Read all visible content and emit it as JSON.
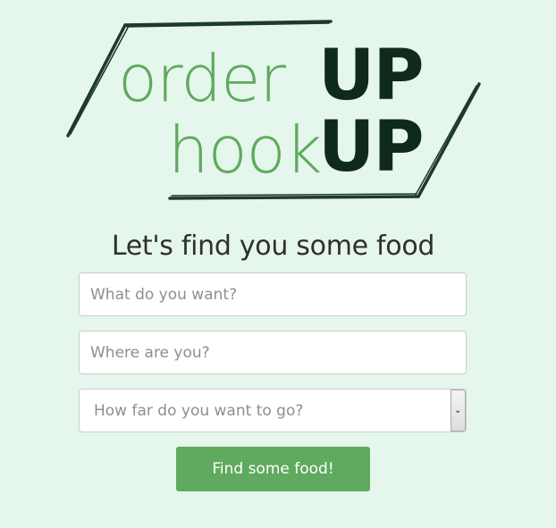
{
  "logo": {
    "line1_light": "order",
    "line1_dark": "UP",
    "line2_light": "hook",
    "line2_dark": "UP"
  },
  "heading": "Let's find you some food",
  "form": {
    "what_placeholder": "What do you want?",
    "where_placeholder": "Where are you?",
    "distance_selected": "How far do you want to go?",
    "submit_label": "Find some food!"
  },
  "colors": {
    "background": "#e5f6ec",
    "accent_green": "#5faa5e",
    "logo_dark": "#0f2a1c",
    "outline": "#1d3a2a"
  },
  "icons": {
    "select_arrow": "chevron-down-icon"
  }
}
